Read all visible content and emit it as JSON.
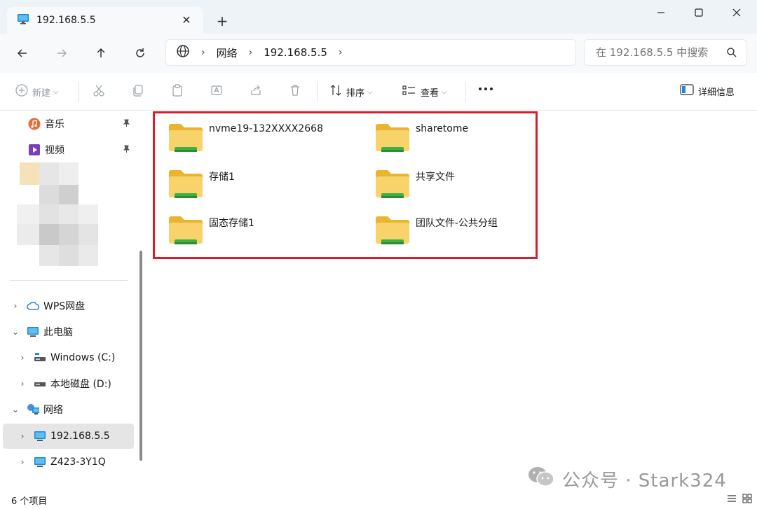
{
  "tab": {
    "title": "192.168.5.5"
  },
  "address": {
    "crumbs": [
      "网络",
      "192.168.5.5"
    ]
  },
  "search": {
    "placeholder": "在 192.168.5.5 中搜索"
  },
  "toolbar": {
    "new_label": "新建",
    "sort_label": "排序",
    "view_label": "查看",
    "details_label": "详细信息"
  },
  "sidebar": {
    "quick_access": [
      {
        "label": "音乐",
        "icon": "music-icon"
      },
      {
        "label": "视频",
        "icon": "video-icon"
      }
    ],
    "tree": [
      {
        "label": "WPS网盘",
        "icon": "cloud-icon"
      },
      {
        "label": "此电脑",
        "icon": "computer-icon"
      },
      {
        "label": "Windows (C:)",
        "icon": "drive-icon"
      },
      {
        "label": "本地磁盘 (D:)",
        "icon": "drive-icon"
      },
      {
        "label": "网络",
        "icon": "network-icon"
      },
      {
        "label": "192.168.5.5",
        "icon": "monitor-icon"
      },
      {
        "label": "Z423-3Y1Q",
        "icon": "monitor-icon"
      }
    ]
  },
  "folders": [
    {
      "name": "nvme19-132XXXX2668"
    },
    {
      "name": "sharetome"
    },
    {
      "name": "存储1"
    },
    {
      "name": "共享文件"
    },
    {
      "name": "固态存储1"
    },
    {
      "name": "团队文件-公共分组"
    }
  ],
  "status": {
    "item_count": "6 个项目"
  },
  "watermark": {
    "text": "公众号 · Stark324"
  },
  "colors": {
    "highlight": "#d81e2c",
    "folder_body": "#f8d26a",
    "folder_share": "#3cb043"
  }
}
